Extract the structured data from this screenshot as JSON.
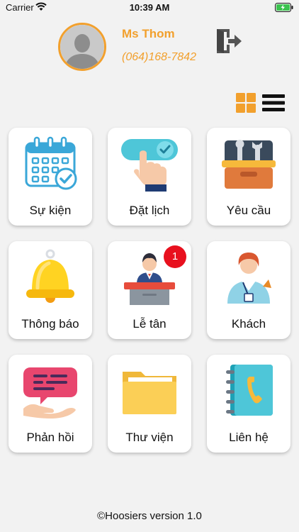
{
  "status_bar": {
    "carrier": "Carrier",
    "time": "10:39 AM"
  },
  "profile": {
    "name": "Ms Thom",
    "phone": "(064)168-7842"
  },
  "accent_color": "#f2a02d",
  "badge_color": "#e8101e",
  "tiles": [
    {
      "label": "Sự kiện",
      "icon": "calendar-icon"
    },
    {
      "label": "Đặt lịch",
      "icon": "booking-toggle-icon"
    },
    {
      "label": "Yêu cầu",
      "icon": "toolbox-icon"
    },
    {
      "label": "Thông báo",
      "icon": "bell-icon"
    },
    {
      "label": "Lễ tân",
      "icon": "receptionist-icon",
      "badge": "1"
    },
    {
      "label": "Khách",
      "icon": "guest-icon"
    },
    {
      "label": "Phản hồi",
      "icon": "feedback-icon"
    },
    {
      "label": "Thư viện",
      "icon": "folder-icon"
    },
    {
      "label": "Liên hệ",
      "icon": "contact-book-icon"
    }
  ],
  "footer": {
    "text": "©Hoosiers version 1.0"
  }
}
